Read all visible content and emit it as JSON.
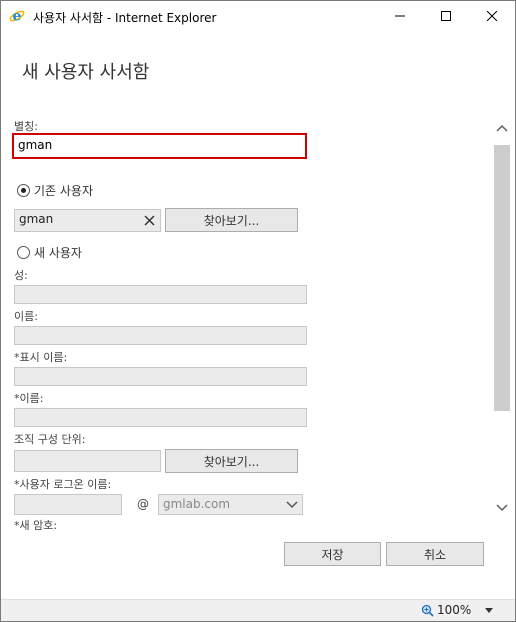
{
  "window": {
    "title": "사용자 사서함 - Internet Explorer"
  },
  "page": {
    "heading": "새 사용자 사서함"
  },
  "form": {
    "alias_label": "별칭:",
    "alias_value": "gman",
    "existing_user_label": "기존 사용자",
    "existing_user_value": "gman",
    "browse_label": "찾아보기...",
    "new_user_label": "새 사용자",
    "last_name_label": "성:",
    "first_name_label": "이름:",
    "display_name_label": "*표시 이름:",
    "name_label": "*이름:",
    "ou_label": "조직 구성 단위:",
    "ou_browse_label": "찾아보기...",
    "logon_name_label": "*사용자 로그온 이름:",
    "at_sign": "@",
    "domain_value": "gmlab.com",
    "new_password_label": "*새 암호:",
    "selected_option": "existing_user"
  },
  "buttons": {
    "save": "저장",
    "cancel": "취소"
  },
  "status": {
    "zoom": "100%"
  },
  "colors": {
    "alias_highlight": "#d00000",
    "ie_blue": "#1e90d6",
    "ie_gold": "#f2b705"
  },
  "icons": {
    "app": "internet-explorer-icon",
    "clear": "x-icon",
    "zoom": "magnifier-icon"
  }
}
